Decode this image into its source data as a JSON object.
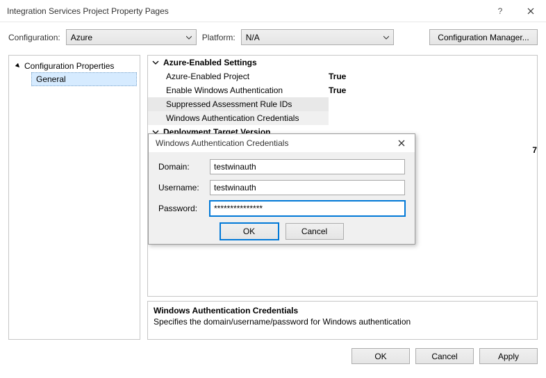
{
  "window": {
    "title": "Integration Services Project Property Pages",
    "help_icon": "?",
    "close_icon": "✕"
  },
  "configbar": {
    "config_label": "Configuration:",
    "config_value": "Azure",
    "platform_label": "Platform:",
    "platform_value": "N/A",
    "manager_button": "Configuration Manager..."
  },
  "tree": {
    "root": "Configuration Properties",
    "child": "General"
  },
  "grid": {
    "group1": "Azure-Enabled Settings",
    "rows1": [
      {
        "label": "Azure-Enabled Project",
        "value": "True"
      },
      {
        "label": "Enable Windows Authentication",
        "value": "True"
      },
      {
        "label": "Suppressed Assessment Rule IDs",
        "value": ""
      },
      {
        "label": "Windows Authentication Credentials",
        "value": ""
      }
    ],
    "group2": "Deployment Target Version",
    "peek_value": "7"
  },
  "description": {
    "title": "Windows Authentication Credentials",
    "text": "Specifies the domain/username/password for Windows authentication"
  },
  "buttons": {
    "ok": "OK",
    "cancel": "Cancel",
    "apply": "Apply"
  },
  "dialog": {
    "title": "Windows Authentication Credentials",
    "domain_label": "Domain:",
    "domain_value": "testwinauth",
    "username_label": "Username:",
    "username_value": "testwinauth",
    "password_label": "Password:",
    "password_value": "***************",
    "ok": "OK",
    "cancel": "Cancel"
  }
}
